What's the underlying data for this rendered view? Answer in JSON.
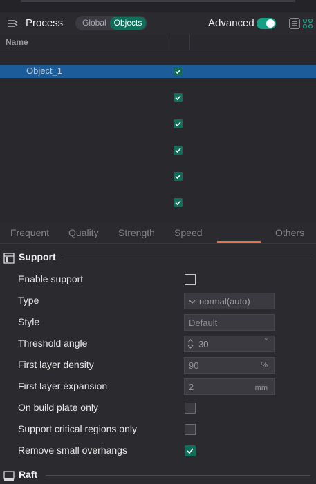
{
  "header": {
    "title": "Process",
    "mode_global": "Global",
    "mode_objects": "Objects",
    "advanced_label": "Advanced",
    "advanced_on": true
  },
  "object_list": {
    "column_name": "Name",
    "rows": [
      {
        "name": "Object_1",
        "selected": true,
        "checked": true
      },
      {
        "name": "",
        "selected": false,
        "checked": true
      },
      {
        "name": "",
        "selected": false,
        "checked": true
      },
      {
        "name": "",
        "selected": false,
        "checked": true
      },
      {
        "name": "",
        "selected": false,
        "checked": true
      },
      {
        "name": "",
        "selected": false,
        "checked": true
      }
    ]
  },
  "tabs": [
    {
      "label": "Frequent",
      "active": false
    },
    {
      "label": "Quality",
      "active": false
    },
    {
      "label": "Strength",
      "active": false
    },
    {
      "label": "Speed",
      "active": false
    },
    {
      "label": "",
      "active": true
    },
    {
      "label": "Others",
      "active": false
    }
  ],
  "support": {
    "title": "Support",
    "enable_support": {
      "label": "Enable support",
      "checked": false
    },
    "type": {
      "label": "Type",
      "value": "normal(auto)"
    },
    "style": {
      "label": "Style",
      "value": "Default"
    },
    "threshold_angle": {
      "label": "Threshold angle",
      "value": "30",
      "unit": "°"
    },
    "first_layer_density": {
      "label": "First layer density",
      "value": "90",
      "unit": "%"
    },
    "first_layer_expansion": {
      "label": "First layer expansion",
      "value": "2",
      "unit": "mm"
    },
    "on_build_plate_only": {
      "label": "On build plate only",
      "checked": false
    },
    "support_critical_regions_only": {
      "label": "Support critical regions only",
      "checked": false
    },
    "remove_small_overhangs": {
      "label": "Remove small overhangs",
      "checked": true
    }
  },
  "raft": {
    "title": "Raft"
  },
  "colors": {
    "accent_green": "#0f6f5b",
    "selection_blue": "#1c5c99",
    "tab_underline": "#e8704f",
    "background": "#2b2b2f"
  }
}
